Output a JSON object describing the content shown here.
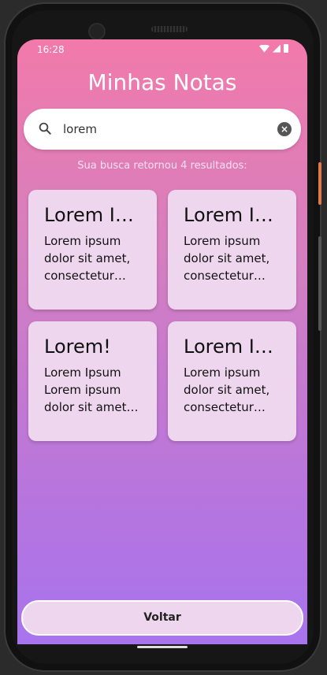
{
  "status_bar": {
    "time": "16:28"
  },
  "header": {
    "title": "Minhas Notas"
  },
  "search": {
    "value": "lorem"
  },
  "results": {
    "text": "Sua busca retornou 4 resultados:"
  },
  "notes": [
    {
      "title": "Lorem Ipsum",
      "body": "Lorem ipsum dolor sit amet, consectetur adipiscing elit"
    },
    {
      "title": "Lorem Ipsum",
      "body": "Lorem ipsum dolor sit amet, consectetur adipiscing elit"
    },
    {
      "title": "Lorem!",
      "body": "Lorem Ipsum Lorem ipsum dolor sit amet, consectetur"
    },
    {
      "title": "Lorem Ipsum",
      "body": "Lorem ipsum dolor sit amet, consectetur adipiscing elit"
    }
  ],
  "footer": {
    "back_label": "Voltar"
  },
  "icons": {
    "search": "search-icon",
    "clear": "clear-icon"
  },
  "colors": {
    "gradient_top": "#f27aaa",
    "gradient_bottom": "#a874ee",
    "card_bg": "#efd6ef"
  }
}
